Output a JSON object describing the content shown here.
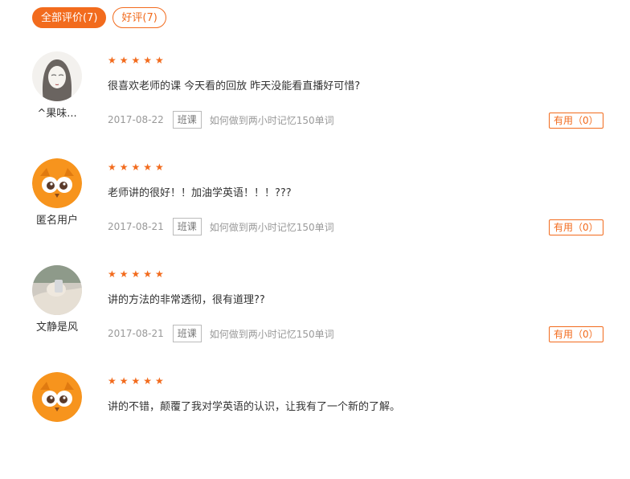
{
  "tabs": [
    {
      "label": "全部评价(7)"
    },
    {
      "label": "好评(7)"
    }
  ],
  "reviews": [
    {
      "username": "^果味...",
      "stars": "★★★★★",
      "content": "很喜欢老师的课 今天看的回放 昨天没能看直播好可惜?",
      "date": "2017-08-22",
      "tag": "班课",
      "course": "如何做到两小时记忆150单词",
      "useful": "有用（0）",
      "avatar": "sketch-girl-avatar"
    },
    {
      "username": "匿名用户",
      "stars": "★★★★★",
      "content": "老师讲的很好！！加油学英语！！！???",
      "date": "2017-08-21",
      "tag": "班课",
      "course": "如何做到两小时记忆150单词",
      "useful": "有用（0）",
      "avatar": "owl-avatar"
    },
    {
      "username": "文静是风",
      "stars": "★★★★★",
      "content": "讲的方法的非常透彻，很有道理??",
      "date": "2017-08-21",
      "tag": "班课",
      "course": "如何做到两小时记忆150单词",
      "useful": "有用（0）",
      "avatar": "photo-avatar"
    },
    {
      "username": "",
      "stars": "★★★★★",
      "content": "讲的不错，颠覆了我对学英语的认识，让我有了一个新的了解。",
      "date": "",
      "tag": "",
      "course": "",
      "useful": "",
      "avatar": "owl-avatar"
    }
  ],
  "colors": {
    "accent": "#f26b1d"
  }
}
